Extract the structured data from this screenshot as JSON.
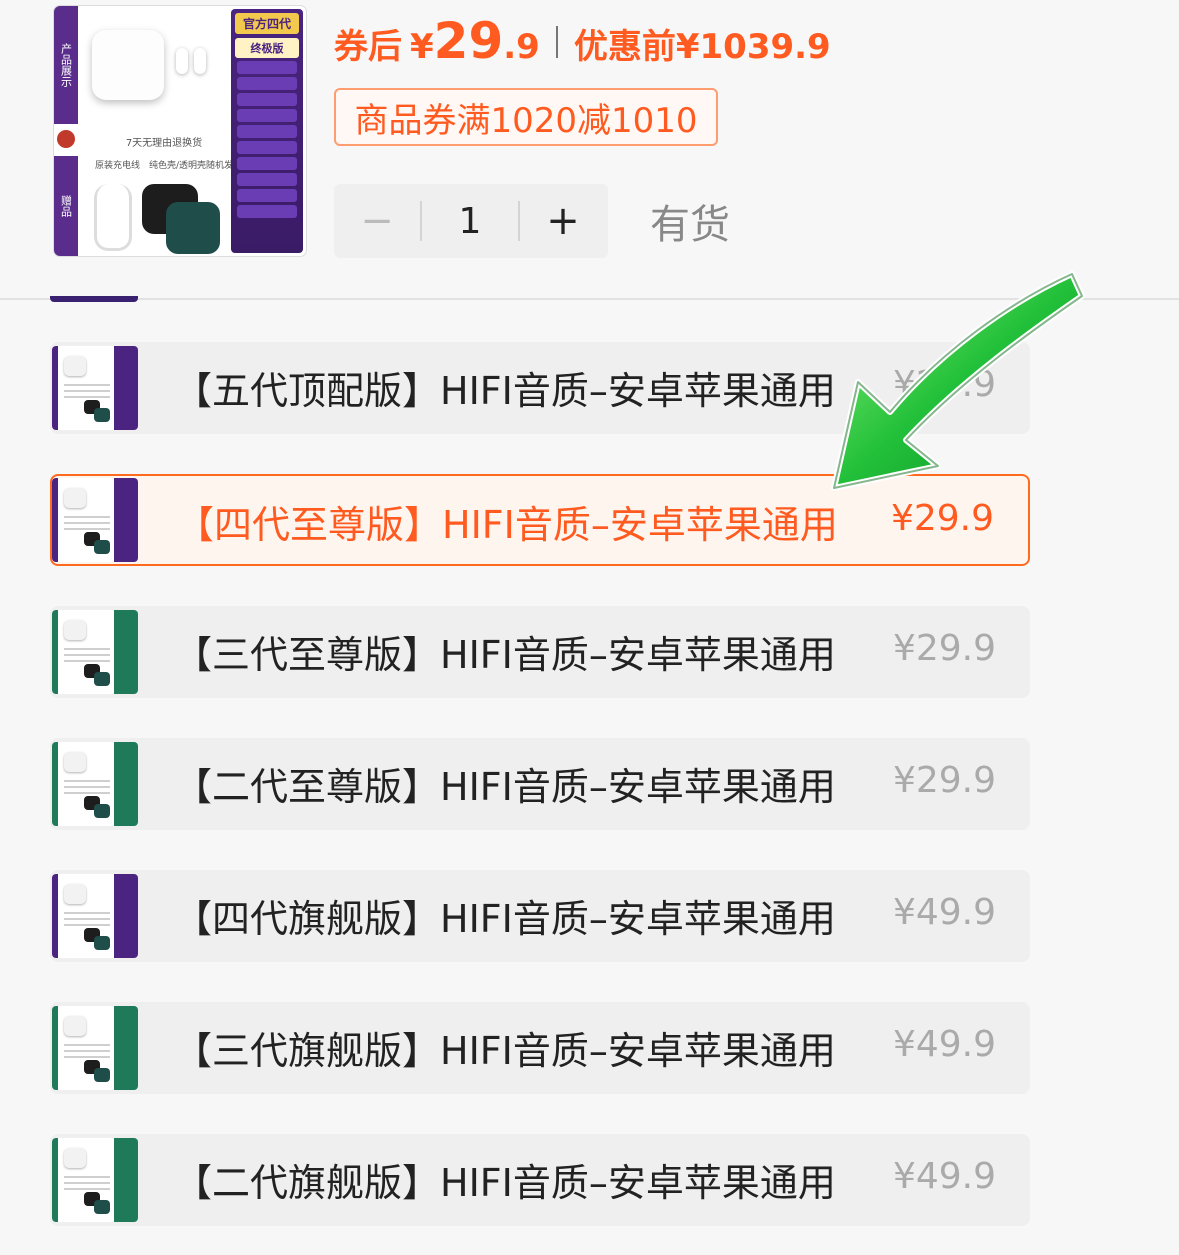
{
  "header": {
    "product_image": {
      "side_label_top": "产品展示",
      "side_label_bottom": "赠品",
      "panel_title": "官方四代",
      "panel_subtitle": "终极版",
      "return_note": "7天无理由退换货",
      "gift_note": "原装充电线　纯色壳/透明壳随机发"
    },
    "price": {
      "after_coupon_label": "券后",
      "currency": "¥",
      "price_integer": "29",
      "price_decimal": ".9",
      "before_label": "优惠前",
      "before_price": "¥1039.9"
    },
    "coupon_text": "商品券满1020减1010",
    "quantity": {
      "minus": "−",
      "value": "1",
      "plus": "+"
    },
    "stock_status": "有货"
  },
  "variants": [
    {
      "name": "【五代顶配版】HIFI音质–安卓苹果通用",
      "price": "¥29.9",
      "theme": "#4a2480",
      "selected": false
    },
    {
      "name": "【四代至尊版】HIFI音质–安卓苹果通用",
      "price": "¥29.9",
      "theme": "#4a2480",
      "selected": true
    },
    {
      "name": "【三代至尊版】HIFI音质–安卓苹果通用",
      "price": "¥29.9",
      "theme": "#1f7a5a",
      "selected": false
    },
    {
      "name": "【二代至尊版】HIFI音质–安卓苹果通用",
      "price": "¥29.9",
      "theme": "#1f7a5a",
      "selected": false
    },
    {
      "name": "【四代旗舰版】HIFI音质–安卓苹果通用",
      "price": "¥49.9",
      "theme": "#4a2480",
      "selected": false
    },
    {
      "name": "【三代旗舰版】HIFI音质–安卓苹果通用",
      "price": "¥49.9",
      "theme": "#1f7a5a",
      "selected": false
    },
    {
      "name": "【二代旗舰版】HIFI音质–安卓苹果通用",
      "price": "¥49.9",
      "theme": "#1f7a5a",
      "selected": false
    }
  ],
  "colors": {
    "accent": "#ff5a1f",
    "arrow_green": "#1fb83a",
    "muted_price": "#aaaaaa"
  },
  "overlay_icon": "green-pointer-arrow-icon"
}
